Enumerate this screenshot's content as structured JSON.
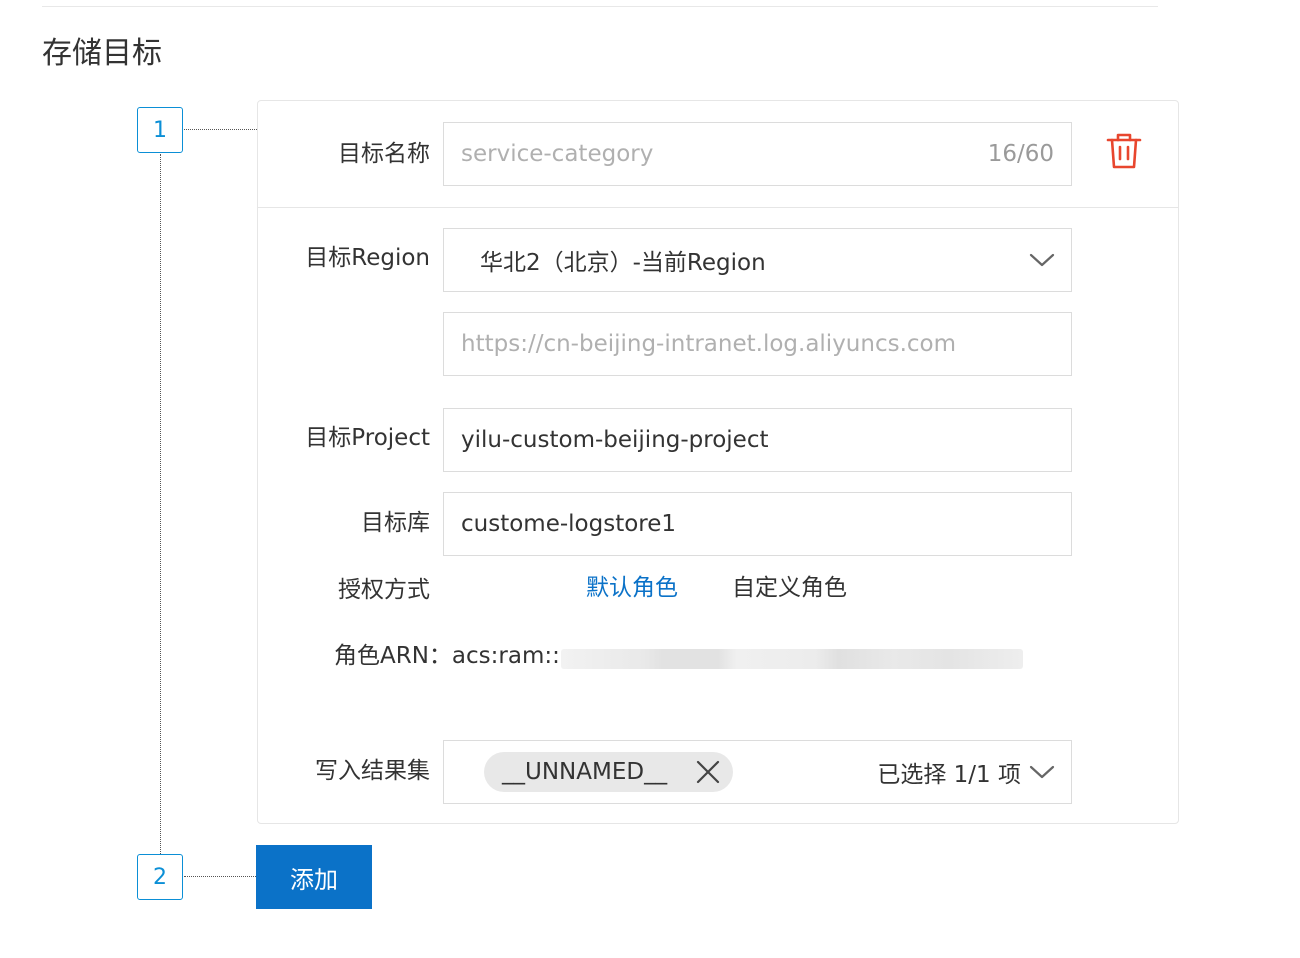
{
  "section": {
    "title": "存储目标"
  },
  "steps": {
    "first": "1",
    "second": "2"
  },
  "target": {
    "name_label": "目标名称",
    "name_placeholder": "service-category",
    "name_count": "16/60",
    "region_label": "目标Region",
    "region_value": "华北2（北京）-当前Region",
    "endpoint_placeholder": "https://cn-beijing-intranet.log.aliyuncs.com",
    "project_label": "目标Project",
    "project_value": "yilu-custom-beijing-project",
    "store_label": "目标库",
    "store_value": "custome-logstore1",
    "auth_label": "授权方式",
    "auth_default": "默认角色",
    "auth_custom": "自定义角色",
    "arn_label": "角色ARN：",
    "arn_value": "acs:ram::",
    "result_label": "写入结果集",
    "result_tag": "__UNNAMED__",
    "result_count": "已选择 1/1 项"
  },
  "actions": {
    "add_label": "添加"
  },
  "colors": {
    "accent": "#0b72c8",
    "step_border": "#0b8fd6",
    "danger": "#e8462e"
  },
  "icons": {
    "delete": "trash-icon",
    "dropdown": "chevron-down-icon",
    "remove_tag": "close-icon"
  }
}
